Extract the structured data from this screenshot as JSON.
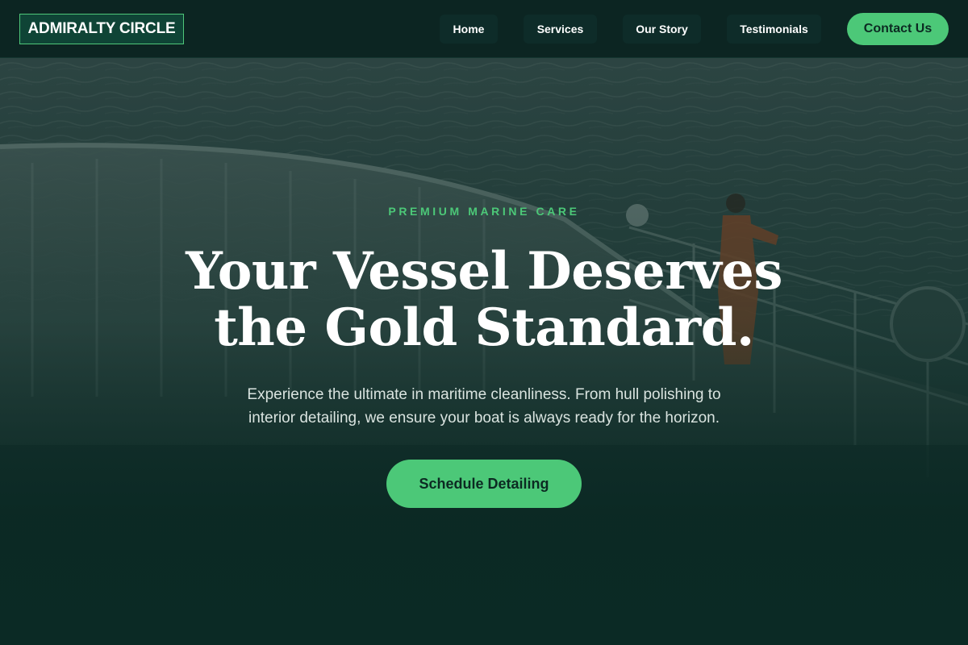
{
  "header": {
    "logo": "ADMIRALTY CIRCLE",
    "nav": [
      "Home",
      "Services",
      "Our Story",
      "Testimonials"
    ],
    "contact": "Contact Us"
  },
  "hero": {
    "eyebrow": "PREMIUM MARINE CARE",
    "headline_line1": "Your Vessel Deserves",
    "headline_line2": "the Gold Standard.",
    "subtext_line1": "Experience the ultimate in maritime cleanliness. From hull polishing to",
    "subtext_line2": "interior detailing, we ensure your boat is always ready for the horizon.",
    "cta": "Schedule Detailing",
    "background_image": "boat-deck-ocean-worker-photo"
  },
  "colors": {
    "accent": "#4cc878",
    "header_bg": "#0c2522",
    "logo_bg": "#0f4436",
    "hero_text": "#ffffff"
  }
}
